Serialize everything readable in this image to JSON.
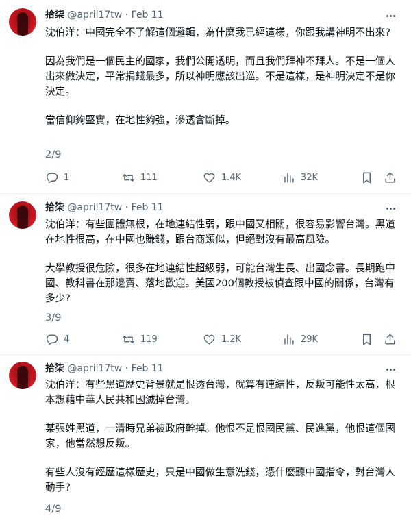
{
  "tweets": [
    {
      "author": "拾柒",
      "handle": "@april17tw",
      "date": "Feb 11",
      "paragraphs": [
        "沈伯洋：中國完全不了解這個邏輯，為什麼我已經這樣，你跟我講神明不出來?",
        "因為我們是一個民主的國家，我們公開透明，而且我們拜神不拜人。不是一個人出來做決定，平常捐錢最多，所以神明應該出巡。不是這樣，是神明決定不是你決定。",
        "當信仰夠堅實，在地性夠強，滲透會斷掉。"
      ],
      "thread_count": "2/9",
      "replies": "1",
      "retweets": "111",
      "likes": "1.4K",
      "views": "32K"
    },
    {
      "author": "拾柒",
      "handle": "@april17tw",
      "date": "Feb 11",
      "paragraphs": [
        "沈伯洋：有些團體無根，在地連結性弱，跟中國又相關，很容易影響台灣。黑道在地性很高，在中國也賺錢，跟台商類似，但絕對沒有最高風險。",
        "大學教授很危險，很多在地連結性超級弱，可能台灣生長、出國念書。長期跑中國、教科書在那邊賣、落地歡迎。美國200個教授被偵查跟中國的關係，台灣有多少?"
      ],
      "thread_count": "3/9",
      "replies": "4",
      "retweets": "119",
      "likes": "1.2K",
      "views": "29K"
    },
    {
      "author": "拾柒",
      "handle": "@april17tw",
      "date": "Feb 11",
      "paragraphs": [
        "沈伯洋：有些黑道歷史背景就是恨透台灣，就算有連結性，反叛可能性太高，根本想藉中華人民共和國滅掉台灣。",
        "某張姓黑道，一清時兄弟被政府幹掉。他恨不是恨國民黨、民進黨，他恨這個國家，他當然想反叛。",
        "有些人沒有經歷這樣歷史，只是中國做生意洗錢，憑什麼聽中國指令，對台灣人動手?"
      ],
      "thread_count": "4/9"
    }
  ],
  "separator": "·"
}
